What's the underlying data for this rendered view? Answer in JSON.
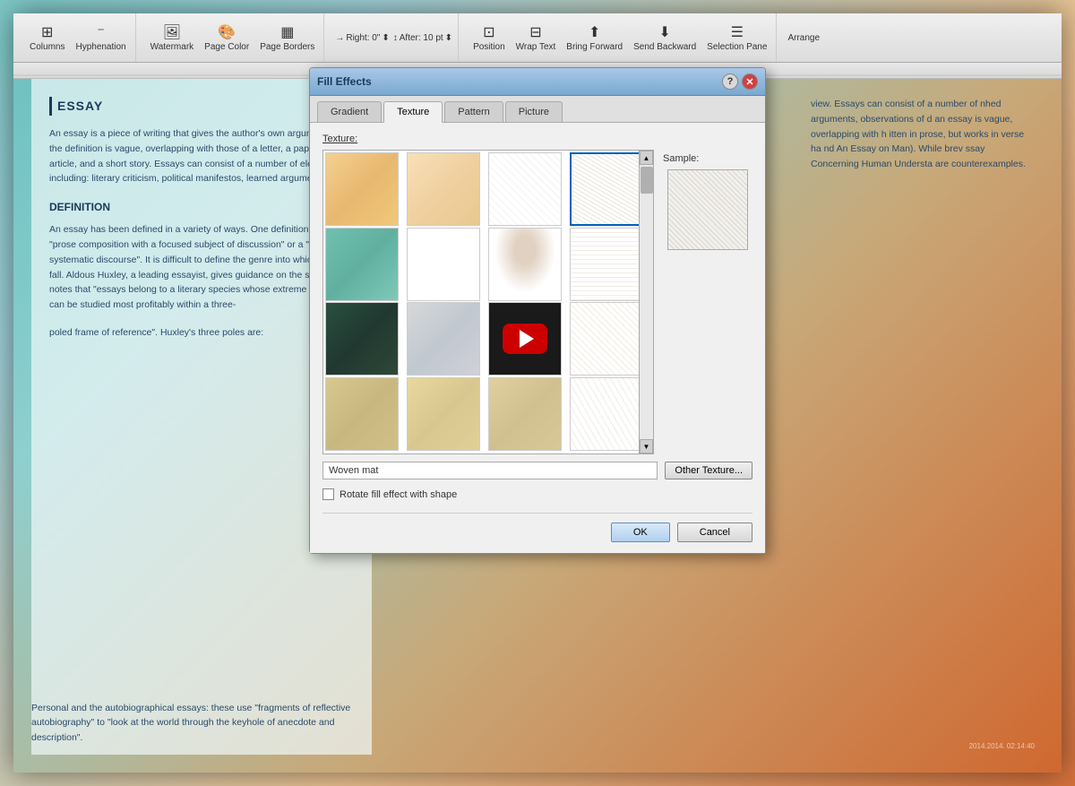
{
  "toolbar": {
    "columns_label": "Columns",
    "hyphenation_label": "Hyphenation",
    "watermark_label": "Watermark",
    "page_color_label": "Page Color",
    "page_borders_label": "Page Borders",
    "right_label": "Right: 0\"",
    "after_label": "After: 10 pt",
    "position_label": "Position",
    "wrap_text_label": "Wrap Text",
    "bring_forward_label": "Bring Forward",
    "send_backward_label": "Send Backward",
    "selection_pane_label": "Selection Pane",
    "arrange_label": "Arrange"
  },
  "dialog": {
    "title": "Fill Effects",
    "tabs": [
      {
        "id": "gradient",
        "label": "Gradient"
      },
      {
        "id": "texture",
        "label": "Texture",
        "active": true
      },
      {
        "id": "pattern",
        "label": "Pattern"
      },
      {
        "id": "picture",
        "label": "Picture"
      }
    ],
    "texture_section_label": "Texture:",
    "sample_label": "Sample:",
    "texture_name": "Woven mat",
    "other_texture_btn": "Other Texture...",
    "rotate_checkbox_label": "Rotate fill effect with shape",
    "ok_btn": "OK",
    "cancel_btn": "Cancel",
    "help_btn": "?",
    "close_btn": "✕"
  },
  "document": {
    "essay_title": "ESSAY",
    "essay_text1": "An essay is a piece of writing that gives the author's own argument, but the definition is vague, overlapping with those of a letter, a paper, an article, and a short story. Essays can consist of a number of elements, including: literary criticism, political manifestos, learned arguments,",
    "essay_text1_right": "view. Essays can consist of a number of nhed arguments, observations of d an essay is vague, overlapping with h itten in prose, but works in verse ha nd An Essay on Man). While brev ssay Concerning Human Understa are counterexamples.",
    "definition_title": "DEFINITION",
    "definition_text": "An essay has been defined in a variety of ways. One definition is a \"prose composition with a focused subject of discussion\" or a \"long, systematic discourse\". It is difficult to define the genre into which essays fall. Aldous Huxley, a leading essayist, gives guidance on the subject. He notes that \"essays belong to a literary species whose extreme variability can be studied most profitably within a three-",
    "definition_text2": "poled frame of reference\". Huxley's three poles are:",
    "personal_text": "Personal and the autobiographical essays: these use \"fragments of reflective autobiography\" to \"look at the world through the keyhole of anecdote and description\".",
    "timestamp": "2014.2014. 02:14:40"
  }
}
